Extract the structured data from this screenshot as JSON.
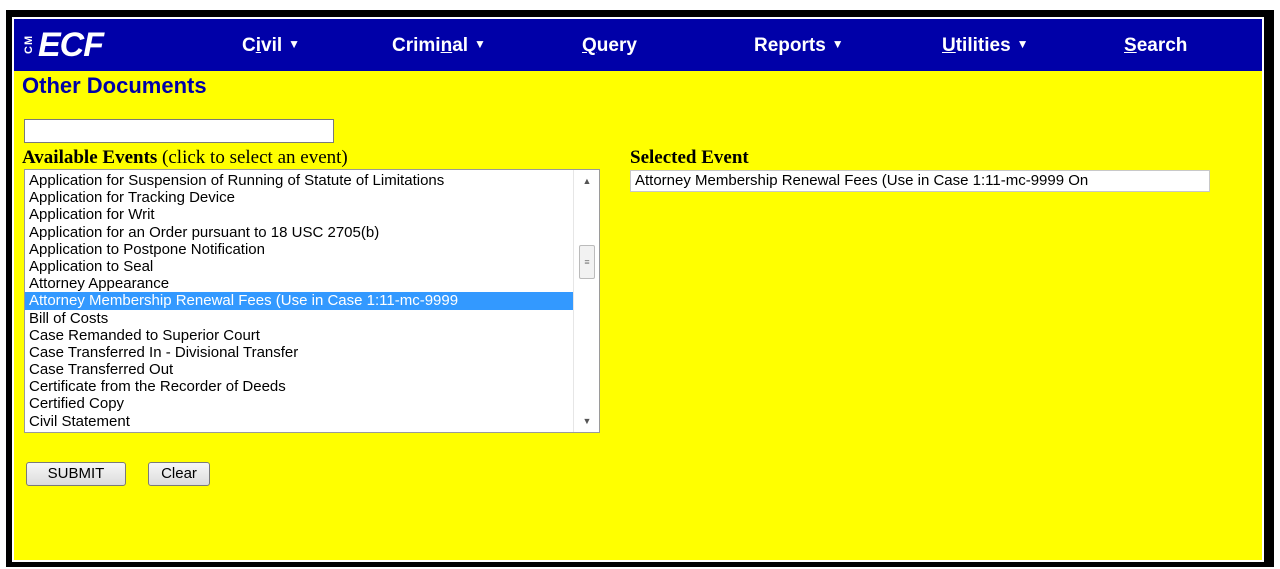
{
  "app": {
    "logo_small": "CM",
    "logo_main": "ECF"
  },
  "nav": {
    "civil": "Civil",
    "criminal": "Criminal",
    "query": "Query",
    "reports": "Reports",
    "utilities": "Utilities",
    "search": "Search"
  },
  "page": {
    "title": "Other Documents"
  },
  "filter": {
    "value": "",
    "placeholder": ""
  },
  "available": {
    "label_bold": "Available Events",
    "label_hint": "(click to select an event)",
    "items": [
      "Application for Suspension of Running of Statute of Limitations",
      "Application for Tracking Device",
      "Application for Writ",
      "Application for an Order pursuant to 18 USC 2705(b)",
      "Application to Postpone Notification",
      "Application to Seal",
      "Attorney Appearance",
      "Attorney Membership Renewal Fees (Use in Case 1:11-mc-9999",
      "Bill of Costs",
      "Case Remanded to Superior Court",
      "Case Transferred In - Divisional Transfer",
      "Case Transferred Out",
      "Certificate from the Recorder of Deeds",
      "Certified Copy",
      "Civil Statement"
    ],
    "selected_index": 7
  },
  "selected": {
    "label": "Selected Event",
    "value": "Attorney Membership Renewal Fees (Use in Case 1:11-mc-9999 On"
  },
  "buttons": {
    "submit": "SUBMIT",
    "clear": "Clear"
  },
  "colors": {
    "page_bg": "#ffff00",
    "navbar_bg": "#0000a8",
    "title_color": "#0000a8",
    "selection_bg": "#3399ff"
  }
}
